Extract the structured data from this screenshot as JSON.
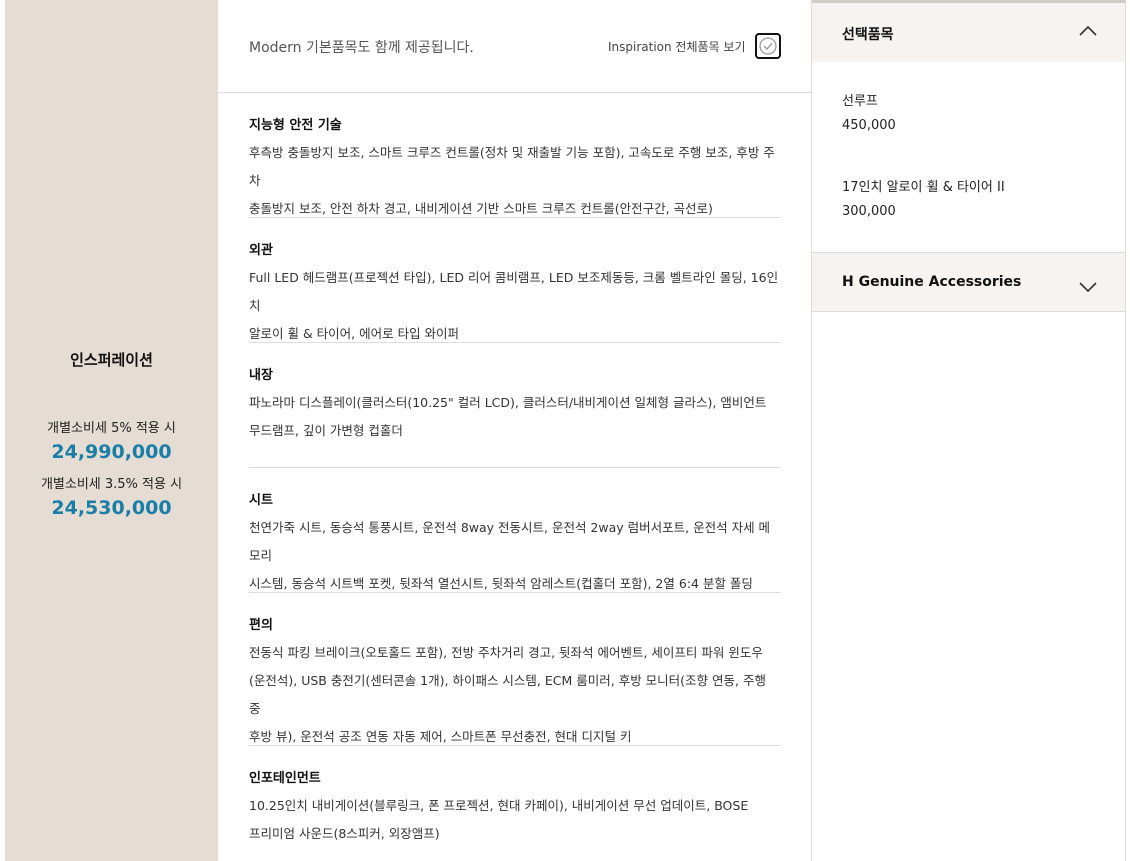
{
  "trim": {
    "name": "인스퍼레이션",
    "tax5_label": "개별소비세 5% 적용 시",
    "tax5_price": "24,990,000",
    "tax35_label": "개별소비세 3.5% 적용 시",
    "tax35_price": "24,530,000"
  },
  "header": {
    "note": "Modern 기본품목도 함께 제공됩니다.",
    "view_all": "Inspiration 전체품목 보기",
    "check_icon": "check-circle-icon"
  },
  "sections": [
    {
      "title": "지능형 안전 기술",
      "lines": [
        "후측방 충돌방지 보조, 스마트 크루즈 컨트롤(정차 및 재출발 기능 포함), 고속도로 주행 보조, 후방 주차",
        "충돌방지 보조, 안전 하차 경고, 내비게이션 기반 스마트 크루즈 컨트롤(안전구간, 곡선로)"
      ]
    },
    {
      "title": "외관",
      "lines": [
        "Full LED 헤드램프(프로젝션 타입), LED 리어 콤비램프, LED 보조제동등, 크롬 벨트라인 몰딩, 16인치",
        "알로이 휠 & 타이어, 에어로 타입 와이퍼"
      ]
    },
    {
      "title": "내장",
      "lines": [
        "파노라마 디스플레이(클러스터(10.25\" 컬러 LCD), 클러스터/내비게이션 일체형 글라스), 앰비언트",
        "무드램프, 깊이 가변형 컵홀더"
      ]
    },
    {
      "title": "시트",
      "lines": [
        "천연가죽 시트, 동승석 통풍시트, 운전석 8way 전동시트, 운전석 2way 럼버서포트, 운전석 자세 메모리",
        "시스템, 동승석 시트백 포켓, 뒷좌석 열선시트, 뒷좌석 암레스트(컵홀더 포함), 2열 6:4 분할 폴딩"
      ]
    },
    {
      "title": "편의",
      "lines": [
        "전동식 파킹 브레이크(오토홀드 포함), 전방 주차거리 경고, 뒷좌석 에어벤트, 세이프티 파워 윈도우",
        "(운전석), USB 충전기(센터콘솔 1개), 하이패스 시스템, ECM 룸미러, 후방 모니터(조향 연동, 주행 중",
        "후방 뷰), 운전석 공조 연동 자동 제어, 스마트폰 무선충전, 현대 디지털 키"
      ]
    },
    {
      "title": "인포테인먼트",
      "lines": [
        "10.25인치 내비게이션(블루링크, 폰 프로젝션, 현대 카페이), 내비게이션 무선 업데이트, BOSE",
        "프리미엄 사운드(8스피커, 외장앰프)"
      ]
    }
  ],
  "selected": {
    "title": "선택품목",
    "toggle_icon": "chevron-up-icon",
    "items": [
      {
        "name": "선루프",
        "price": "450,000"
      },
      {
        "name": "17인치 알로이 휠 & 타이어 II",
        "price": "300,000"
      }
    ]
  },
  "accessories": {
    "title": "H Genuine Accessories",
    "toggle_icon": "chevron-down-icon"
  },
  "colors": {
    "left_bg": "#e5dcd3",
    "price": "#1a7fa8",
    "panel_header_bg": "#f6f3f1",
    "divider": "#dcdcdc"
  }
}
